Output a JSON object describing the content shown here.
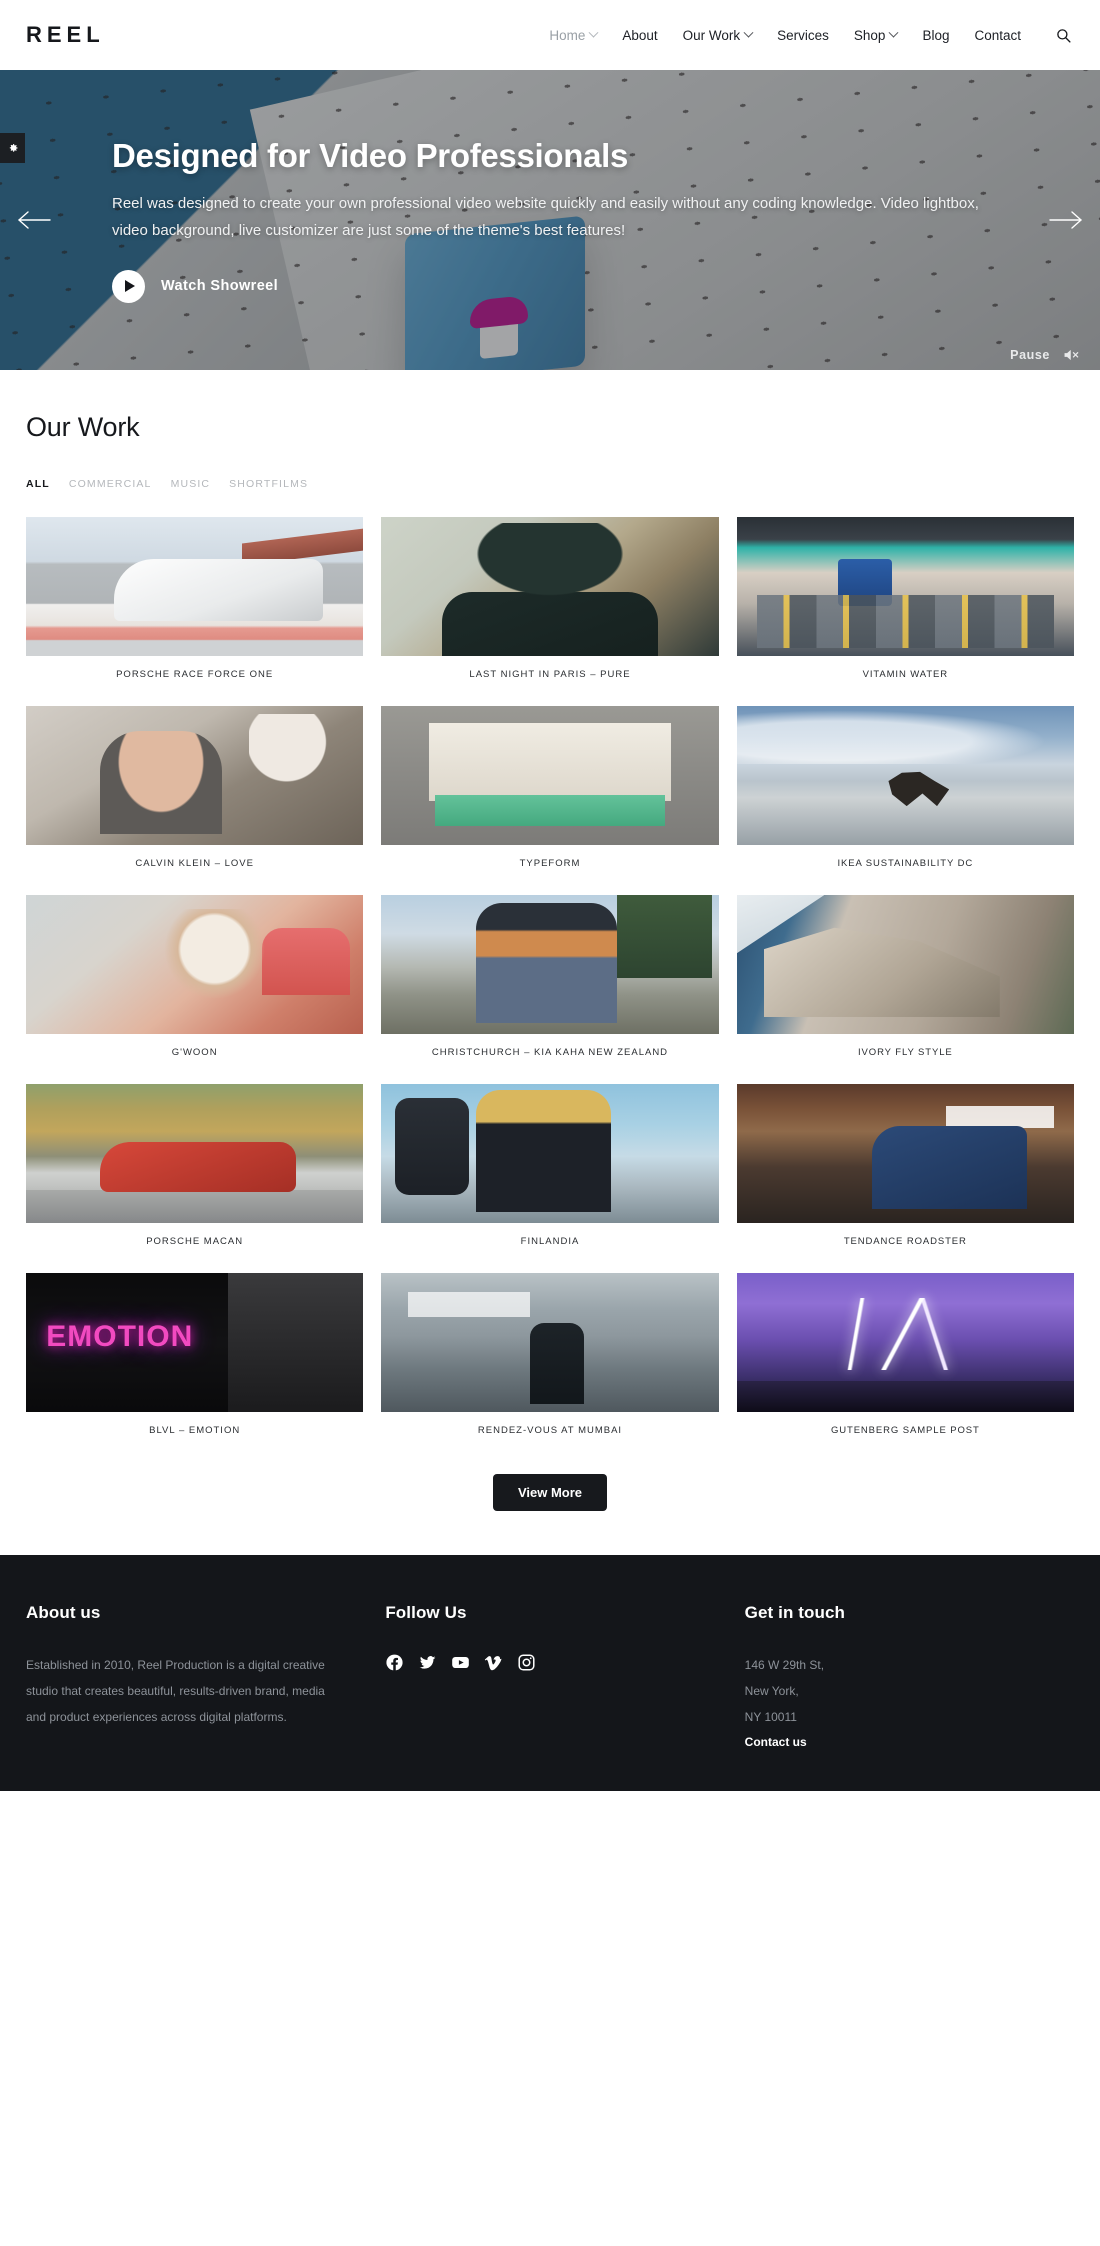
{
  "header": {
    "brand": "REEL",
    "nav": [
      {
        "label": "Home",
        "caret": true,
        "muted": true
      },
      {
        "label": "About",
        "caret": false,
        "muted": false
      },
      {
        "label": "Our Work",
        "caret": true,
        "muted": false
      },
      {
        "label": "Services",
        "caret": false,
        "muted": false
      },
      {
        "label": "Shop",
        "caret": true,
        "muted": false
      },
      {
        "label": "Blog",
        "caret": false,
        "muted": false
      },
      {
        "label": "Contact",
        "caret": false,
        "muted": false
      }
    ],
    "search_icon": "search-icon"
  },
  "hero": {
    "title": "Designed for Video Professionals",
    "subtitle": "Reel was designed to create your own professional video website quickly and easily without any coding knowledge. Video lightbox, video background, live customizer are just some of the theme's best features!",
    "cta_label": "Watch Showreel",
    "pause_label": "Pause",
    "mute_icon": "speaker-muted-icon",
    "gear_icon": "gear-icon",
    "prev_icon": "arrow-left-icon",
    "next_icon": "arrow-right-icon"
  },
  "work": {
    "title": "Our Work",
    "filters": [
      {
        "label": "ALL",
        "active": true
      },
      {
        "label": "COMMERCIAL",
        "active": false
      },
      {
        "label": "MUSIC",
        "active": false
      },
      {
        "label": "SHORTFILMS",
        "active": false
      }
    ],
    "items": [
      {
        "caption": "PORSCHE RACE FORCE ONE",
        "art": "ph-porsche-race"
      },
      {
        "caption": "LAST NIGHT IN PARIS – PURE",
        "art": "ph-paris"
      },
      {
        "caption": "VITAMIN WATER",
        "art": "ph-vitamin"
      },
      {
        "caption": "CALVIN KLEIN – LOVE",
        "art": "ph-calvin"
      },
      {
        "caption": "TYPEFORM",
        "art": "ph-typeform"
      },
      {
        "caption": "IKEA SUSTAINABILITY DC",
        "art": "ph-ikea"
      },
      {
        "caption": "G'WOON",
        "art": "ph-gwoon"
      },
      {
        "caption": "CHRISTCHURCH – KIA KAHA NEW ZEALAND",
        "art": "ph-christchurch"
      },
      {
        "caption": "IVORY FLY STYLE",
        "art": "ph-ivory"
      },
      {
        "caption": "PORSCHE MACAN",
        "art": "ph-macan"
      },
      {
        "caption": "FINLANDIA",
        "art": "ph-finlandia"
      },
      {
        "caption": "TENDANCE ROADSTER",
        "art": "ph-tendance"
      },
      {
        "caption": "BLVL – EMOTION",
        "art": "ph-emotion"
      },
      {
        "caption": "RENDEZ-VOUS AT MUMBAI",
        "art": "ph-mumbai"
      },
      {
        "caption": "GUTENBERG SAMPLE POST",
        "art": "ph-gutenberg"
      }
    ],
    "view_more_label": "View More"
  },
  "footer": {
    "about": {
      "title": "About us",
      "text": "Established in 2010, Reel Production is a digital creative studio that creates beautiful, results-driven brand, media and product experiences across digital platforms."
    },
    "follow": {
      "title": "Follow Us",
      "socials": [
        "facebook-icon",
        "twitter-icon",
        "youtube-icon",
        "vimeo-icon",
        "instagram-icon"
      ]
    },
    "contact": {
      "title": "Get in touch",
      "address_line1": "146 W 29th St,",
      "address_line2": "New York,",
      "address_line3": "NY 10011",
      "link_label": "Contact us"
    }
  },
  "colors": {
    "accent_dark": "#17191d",
    "footer_bg": "#14161a",
    "muted_text": "#8d9299",
    "hero_blue": "#3d7ba5",
    "emotion_pink": "#f24ac0"
  }
}
